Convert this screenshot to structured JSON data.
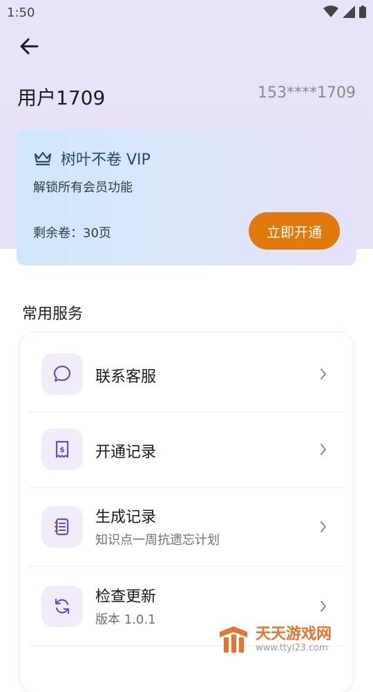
{
  "status_bar": {
    "time": "1:50"
  },
  "header": {
    "username": "用户1709",
    "phone": "153****1709"
  },
  "vip_card": {
    "title": "树叶不卷 VIP",
    "subtitle": "解锁所有会员功能",
    "remaining": "剩余卷：30页",
    "button_label": "立即开通",
    "accent_color": "#e07b0b"
  },
  "services": {
    "title": "常用服务",
    "items": [
      {
        "icon": "chat-bubble-icon",
        "label": "联系客服",
        "subtitle": ""
      },
      {
        "icon": "receipt-icon",
        "label": "开通记录",
        "subtitle": ""
      },
      {
        "icon": "document-list-icon",
        "label": "生成记录",
        "subtitle": "知识点一周抗遗忘计划"
      },
      {
        "icon": "refresh-icon",
        "label": "检查更新",
        "subtitle": "版本 1.0.1"
      }
    ]
  },
  "watermark": {
    "brand": "天天游戏网",
    "url": "www.ttyl23.com"
  }
}
